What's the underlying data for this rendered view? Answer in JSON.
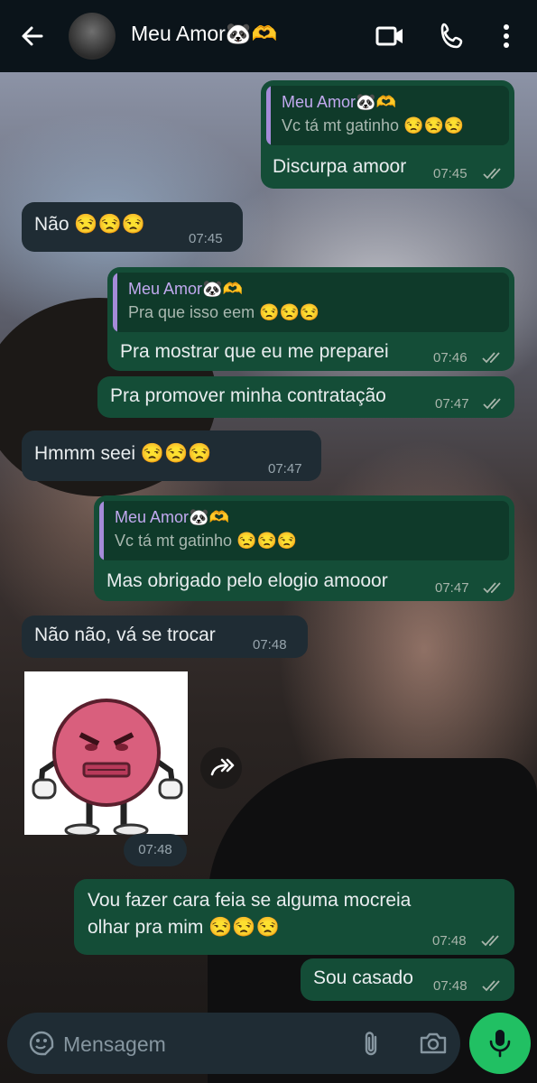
{
  "header": {
    "contact_name": "Meu Amor🐼🫶",
    "back_icon": "arrow-left-icon",
    "video_icon": "video-camera-icon",
    "call_icon": "phone-icon",
    "menu_icon": "more-vertical-icon"
  },
  "messages": [
    {
      "dir": "out",
      "quote_author": "Meu Amor🐼🫶",
      "quote_text": "Vc tá mt gatinho 😒😒😒",
      "text": "Discurpa amoor",
      "time": "07:45"
    },
    {
      "dir": "in",
      "text": "Não 😒😒😒",
      "time": "07:45"
    },
    {
      "dir": "out",
      "quote_author": "Meu Amor🐼🫶",
      "quote_text": "Pra que isso eem 😒😒😒",
      "text": "Pra mostrar que eu me preparei",
      "time": "07:46"
    },
    {
      "dir": "out",
      "text": "Pra promover minha contratação",
      "time": "07:47"
    },
    {
      "dir": "in",
      "text": "Hmmm seei 😒😒😒",
      "time": "07:47"
    },
    {
      "dir": "out",
      "quote_author": "Meu Amor🐼🫶",
      "quote_text": "Vc tá mt gatinho 😒😒😒",
      "text": "Mas obrigado pelo elogio amooor",
      "time": "07:47"
    },
    {
      "dir": "in",
      "text": "Não não, vá se trocar",
      "time": "07:48"
    },
    {
      "dir": "in",
      "type": "sticker",
      "sticker": "angry-pink-ball-sticker",
      "time": "07:48"
    },
    {
      "dir": "out",
      "text_line1": "Vou fazer cara feia se alguma mocreia",
      "text_line2": "olhar pra mim 😒😒😒",
      "time": "07:48"
    },
    {
      "dir": "out",
      "text": "Sou casado",
      "time": "07:48"
    }
  ],
  "composer": {
    "placeholder": "Mensagem",
    "emoji_icon": "emoji-icon",
    "attach_icon": "paperclip-icon",
    "camera_icon": "camera-icon",
    "mic_icon": "microphone-icon"
  },
  "colors": {
    "outgoing_bubble": "#144d37",
    "incoming_bubble": "#1f2c34",
    "header_bg": "#0b141a",
    "quote_author": "#c1a9ef",
    "mic_button": "#21c063"
  }
}
